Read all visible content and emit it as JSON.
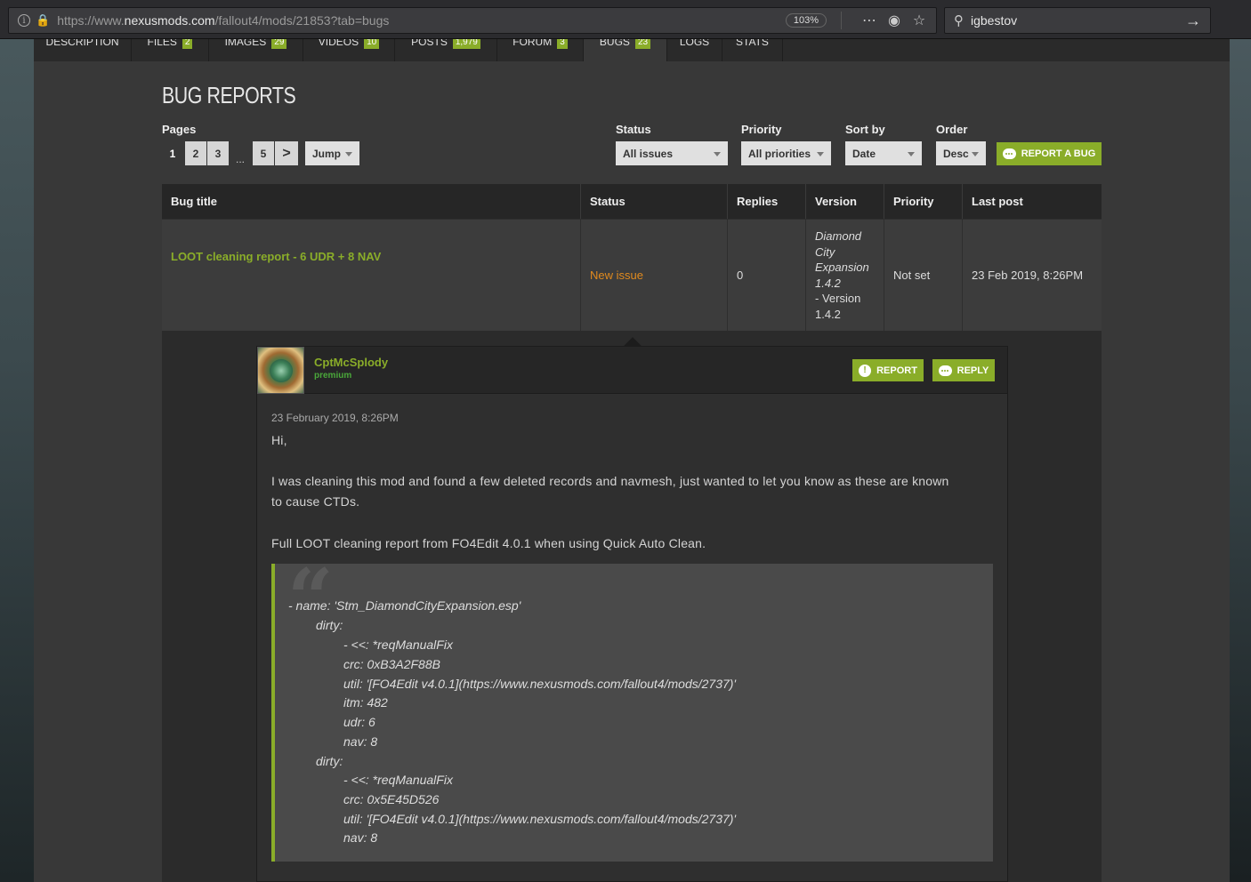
{
  "browser": {
    "url_prefix": "https://www.",
    "url_domain": "nexusmods.com",
    "url_path": "/fallout4/mods/21853?tab=bugs",
    "zoom": "103%",
    "search_query": "igbestov"
  },
  "tabs": [
    {
      "label": "Description",
      "count": ""
    },
    {
      "label": "Files",
      "count": "2"
    },
    {
      "label": "Images",
      "count": "29"
    },
    {
      "label": "Videos",
      "count": "10"
    },
    {
      "label": "Posts",
      "count": "1,979"
    },
    {
      "label": "Forum",
      "count": "3"
    },
    {
      "label": "Bugs",
      "count": "23"
    },
    {
      "label": "Logs",
      "count": ""
    },
    {
      "label": "Stats",
      "count": ""
    }
  ],
  "page_title": "BUG REPORTS",
  "pagination": {
    "label": "Pages",
    "pages": [
      "1",
      "2",
      "3",
      "5"
    ],
    "ellipsis": "...",
    "next_symbol": ">",
    "jump_label": "Jump"
  },
  "filters": {
    "status_label": "Status",
    "status_value": "All issues",
    "priority_label": "Priority",
    "priority_value": "All priorities",
    "sort_label": "Sort by",
    "sort_value": "Date",
    "order_label": "Order",
    "order_value": "Desc"
  },
  "report_bug_label": "REPORT A BUG",
  "table": {
    "headers": [
      "Bug title",
      "Status",
      "Replies",
      "Version",
      "Priority",
      "Last post"
    ],
    "row": {
      "title": "LOOT cleaning report - 6 UDR + 8 NAV",
      "status": "New issue",
      "replies": "0",
      "version_lines": [
        "Diamond",
        "City",
        "Expansion",
        "1.4.2"
      ],
      "version_suffix_lines": [
        "- Version",
        "1.4.2"
      ],
      "priority": "Not set",
      "last_post": "23 Feb 2019, 8:26PM"
    }
  },
  "comment": {
    "username": "CptMcSplody",
    "role": "premium",
    "report_label": "REPORT",
    "reply_label": "REPLY",
    "date": "23 February 2019, 8:26PM",
    "greeting": "Hi,",
    "para1_line1": "I was cleaning this mod and found a few deleted records and navmesh, just wanted to let you know as these are known",
    "para1_line2": "to cause CTDs.",
    "para2": "Full LOOT cleaning report from FO4Edit 4.0.1 when using Quick Auto Clean.",
    "quote_lines": [
      "- name: 'Stm_DiamondCityExpansion.esp'",
      "dirty:",
      "- <<: *reqManualFix",
      "crc: 0xB3A2F88B",
      "util: '[FO4Edit v4.0.1](https://www.nexusmods.com/fallout4/mods/2737)'",
      "itm: 482",
      "udr: 6",
      "nav: 8",
      "dirty:",
      "- <<: *reqManualFix",
      "crc: 0x5E45D526",
      "util: '[FO4Edit v4.0.1](https://www.nexusmods.com/fallout4/mods/2737)'",
      "nav: 8"
    ]
  },
  "colors": {
    "accent": "#8aad29",
    "status_new": "#e08a1e",
    "premium": "#4aa83a"
  },
  "icons": [
    "info-icon",
    "lock-icon",
    "more-icon",
    "pocket-icon",
    "star-icon",
    "search-icon",
    "arrow-right-icon",
    "chat-bubble-icon",
    "exclamation-icon"
  ]
}
